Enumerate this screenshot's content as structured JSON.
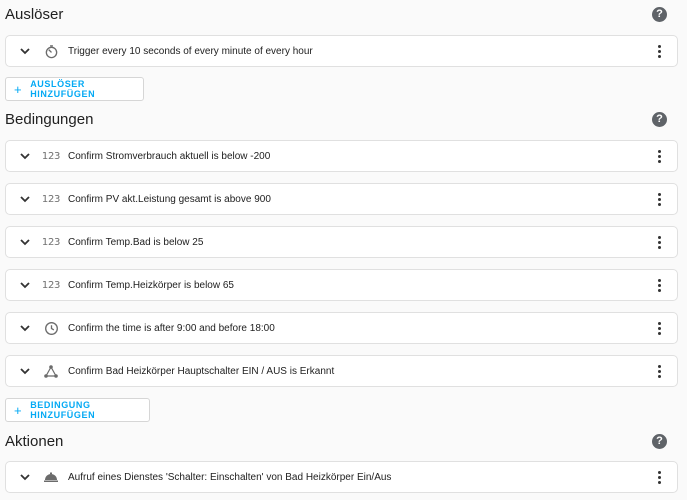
{
  "triggers": {
    "title": "Auslöser",
    "help_icon": "question-circle-icon",
    "items": [
      {
        "label": "Trigger every 10 seconds of every minute of every hour",
        "icon": "timer-icon"
      }
    ],
    "add_label": "AUSLÖSER HINZUFÜGEN"
  },
  "conditions": {
    "title": "Bedingungen",
    "help_icon": "question-circle-icon",
    "items": [
      {
        "label": "Confirm Stromverbrauch aktuell is below -200",
        "icon": "numeric-123-icon",
        "glyph": "123"
      },
      {
        "label": "Confirm PV akt.Leistung gesamt is above 900",
        "icon": "numeric-123-icon",
        "glyph": "123"
      },
      {
        "label": "Confirm Temp.Bad is below 25",
        "icon": "numeric-123-icon",
        "glyph": "123"
      },
      {
        "label": "Confirm Temp.Heizkörper is below 65",
        "icon": "numeric-123-icon",
        "glyph": "123"
      },
      {
        "label": "Confirm the time is after 9:00 and before 18:00",
        "icon": "clock-icon"
      },
      {
        "label": "Confirm Bad Heizkörper Hauptschalter EIN / AUS is Erkannt",
        "icon": "state-graph-icon"
      }
    ],
    "add_label": "BEDINGUNG HINZUFÜGEN"
  },
  "actions": {
    "title": "Aktionen",
    "help_icon": "question-circle-icon",
    "items": [
      {
        "label": "Aufruf eines Dienstes 'Schalter: Einschalten' von Bad Heizkörper Ein/Aus",
        "icon": "service-bell-icon"
      }
    ]
  },
  "colors": {
    "accent": "#03a9f4",
    "background": "#fafafa",
    "card": "#ffffff",
    "border": "#e0e0e0"
  }
}
